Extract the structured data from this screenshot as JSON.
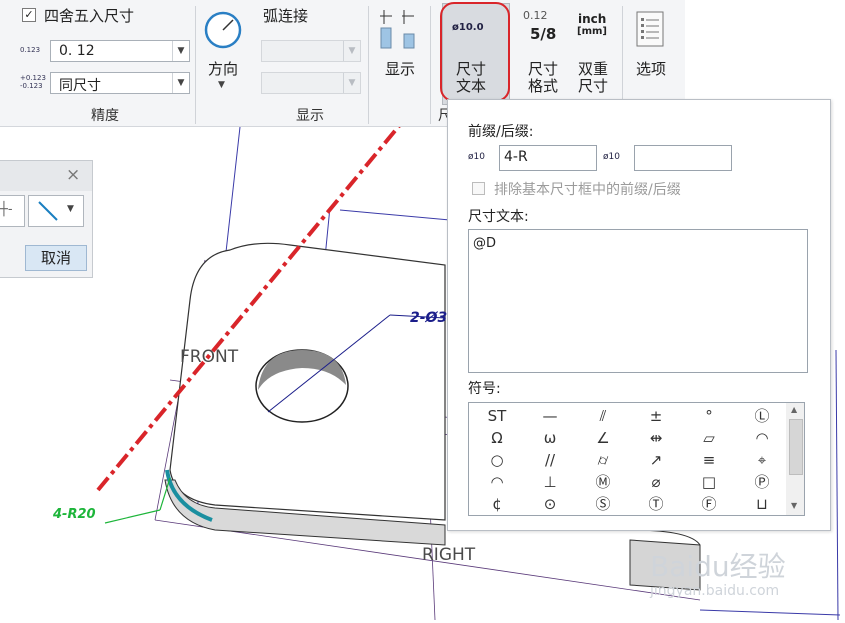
{
  "ribbon": {
    "round_checkbox_label": "四舍五入尺寸",
    "precision_icon_text": "0.123",
    "precision_value": "0. 12",
    "tolerance_icon_text_top": "+0.123",
    "tolerance_icon_text_bottom": "-0.123",
    "tolerance_value": "同尺寸",
    "precision_group_label": "精度",
    "direction_label": "方向",
    "arc_connect_label": "弧连接",
    "display_button_label": "显示",
    "display_group_label": "显示",
    "dim_text_icon_text": "ø10.0",
    "dim_text_button_line1": "尺寸",
    "dim_text_button_line2": "文本",
    "dim_format_icon_top": "0.12",
    "dim_format_icon_bottom": "5/8",
    "dim_format_line1": "尺寸",
    "dim_format_line2": "格式",
    "dual_icon_top": "inch",
    "dual_icon_bottom": "[mm]",
    "dual_line1": "双重",
    "dual_line2": "尺寸",
    "options_label": "选项",
    "partial_group_label": "尺"
  },
  "mini_dialog": {
    "close_glyph": "×",
    "cancel_label": "取消"
  },
  "panel": {
    "prefix_suffix_label": "前缀/后缀:",
    "prefix_icon_text": "ø10",
    "prefix_value": "4-R",
    "suffix_icon_text": "ø10",
    "suffix_value": "",
    "exclude_label": "排除基本尺寸框中的前缀/后缀",
    "dim_text_label": "尺寸文本:",
    "dim_text_value": "@D",
    "symbols_label": "符号:",
    "symbols": [
      [
        "ST",
        "—",
        "⫽",
        "±",
        "°",
        "Ⓛ"
      ],
      [
        "Ω",
        "ω",
        "∠",
        "⇹",
        "▱",
        "◠"
      ],
      [
        "○",
        "//",
        "⌭",
        "↗",
        "≡",
        "⌖"
      ],
      [
        "◠",
        "⊥",
        "Ⓜ",
        "⌀",
        "□",
        "Ⓟ"
      ],
      [
        "¢",
        "⊙",
        "Ⓢ",
        "Ⓣ",
        "Ⓕ",
        "⊔"
      ]
    ]
  },
  "canvas": {
    "front_label": "FRONT",
    "right_label": "RIGHT",
    "hole_dim_label": "2-Ø3",
    "radius_dim_label": "4-R20"
  },
  "watermark": {
    "text": "Baidu经验",
    "subtext": "jingyan.baidu.com"
  },
  "colors": {
    "highlight_red": "#d9252a",
    "radius_green": "#1db53a",
    "edge_teal": "#1a8fa0",
    "dim_navy": "#1b1e8a"
  }
}
